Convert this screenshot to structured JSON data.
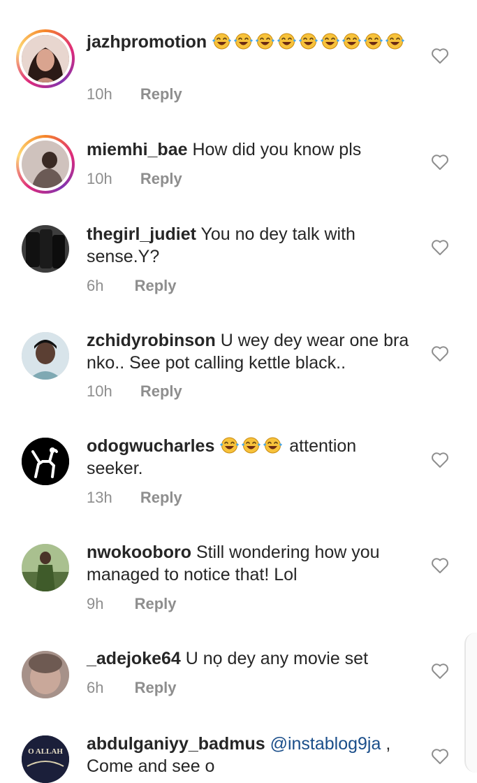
{
  "comments": [
    {
      "username": "jazhpromotion",
      "text": "",
      "emojis": 9,
      "time": "10h",
      "reply": "Reply",
      "story": true,
      "avatar_color": "#7a5c4e"
    },
    {
      "username": "miemhi_bae",
      "text": "How did you know pls",
      "time": "10h",
      "reply": "Reply",
      "story": true,
      "avatar_color": "#b9a49a"
    },
    {
      "username": "thegirl_judiet",
      "text": "You no dey talk with sense.Y?",
      "time": "6h",
      "reply": "Reply",
      "story": false,
      "avatar_color": "#2a2a2a"
    },
    {
      "username": "zchidyrobinson",
      "text": "U wey dey wear one bra nko.. See pot calling kettle black..",
      "time": "10h",
      "reply": "Reply",
      "story": false,
      "avatar_color": "#5b6f6e"
    },
    {
      "username": "odogwucharles",
      "text_after_emoji": "attention seeker.",
      "emojis": 3,
      "time": "13h",
      "reply": "Reply",
      "story": false,
      "avatar_color": "#000000"
    },
    {
      "username": "nwokooboro",
      "text": "Still wondering how you managed to notice that! Lol",
      "time": "9h",
      "reply": "Reply",
      "story": false,
      "avatar_color": "#4f6b3c"
    },
    {
      "username": "_adejoke64",
      "text": "U nọ dey any movie set",
      "time": "6h",
      "reply": "Reply",
      "story": false,
      "avatar_color": "#8d7a74"
    },
    {
      "username": "abdulganiyy_badmus",
      "mention": "@instablog9ja",
      "text_after_mention": " ,",
      "text_line2": "Come and see o",
      "story": false,
      "avatar_color": "#1b1f3a",
      "avatar_text": "O ALLAH"
    }
  ],
  "icons": {
    "like": "heart-outline-icon",
    "emoji": "tears-of-joy-emoji"
  },
  "colors": {
    "username": "#262626",
    "meta": "#8e8e8e",
    "mention": "#1a4e8a"
  }
}
